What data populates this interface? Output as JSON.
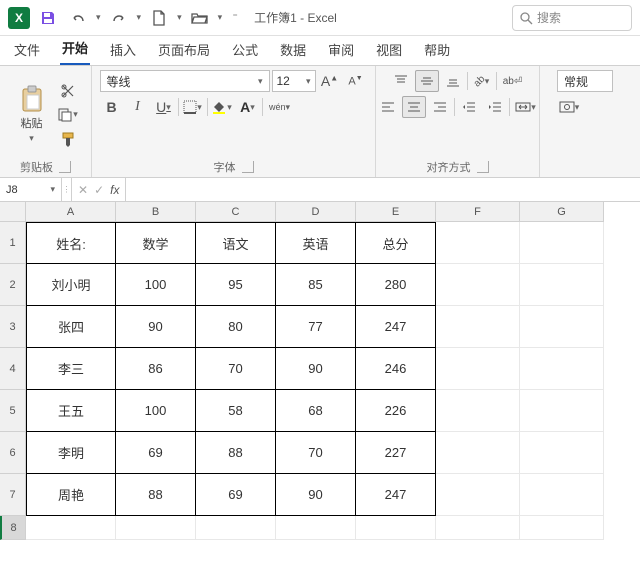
{
  "titlebar": {
    "doc_title": "工作簿1",
    "app_name": "Excel",
    "title_sep": "-",
    "search_placeholder": "搜索"
  },
  "menutabs": [
    "文件",
    "开始",
    "插入",
    "页面布局",
    "公式",
    "数据",
    "审阅",
    "视图",
    "帮助"
  ],
  "menutabs_active_index": 1,
  "ribbon": {
    "clipboard": {
      "paste": "粘贴",
      "group_label": "剪贴板"
    },
    "font": {
      "font_name": "等线",
      "font_size": "12",
      "bold": "B",
      "italic": "I",
      "underline": "U",
      "wen": "wén",
      "group_label": "字体"
    },
    "align": {
      "group_label": "对齐方式"
    },
    "number": {
      "format": "常规"
    }
  },
  "formulabar": {
    "namebox": "J8",
    "fx": "fx",
    "value": ""
  },
  "grid": {
    "col_headers": [
      "A",
      "B",
      "C",
      "D",
      "E",
      "F",
      "G"
    ],
    "row_headers": [
      "1",
      "2",
      "3",
      "4",
      "5",
      "6",
      "7",
      "8"
    ],
    "data": [
      [
        "姓名:",
        "数学",
        "语文",
        "英语",
        "总分"
      ],
      [
        "刘小明",
        "100",
        "95",
        "85",
        "280"
      ],
      [
        "张四",
        "90",
        "80",
        "77",
        "247"
      ],
      [
        "李三",
        "86",
        "70",
        "90",
        "246"
      ],
      [
        "王五",
        "100",
        "58",
        "68",
        "226"
      ],
      [
        "李明",
        "69",
        "88",
        "70",
        "227"
      ],
      [
        "周艳",
        "88",
        "69",
        "90",
        "247"
      ]
    ]
  },
  "chart_data": {
    "type": "table",
    "columns": [
      "姓名:",
      "数学",
      "语文",
      "英语",
      "总分"
    ],
    "rows": [
      [
        "刘小明",
        100,
        95,
        85,
        280
      ],
      [
        "张四",
        90,
        80,
        77,
        247
      ],
      [
        "李三",
        86,
        70,
        90,
        246
      ],
      [
        "王五",
        100,
        58,
        68,
        226
      ],
      [
        "李明",
        69,
        88,
        70,
        227
      ],
      [
        "周艳",
        88,
        69,
        90,
        247
      ]
    ]
  }
}
